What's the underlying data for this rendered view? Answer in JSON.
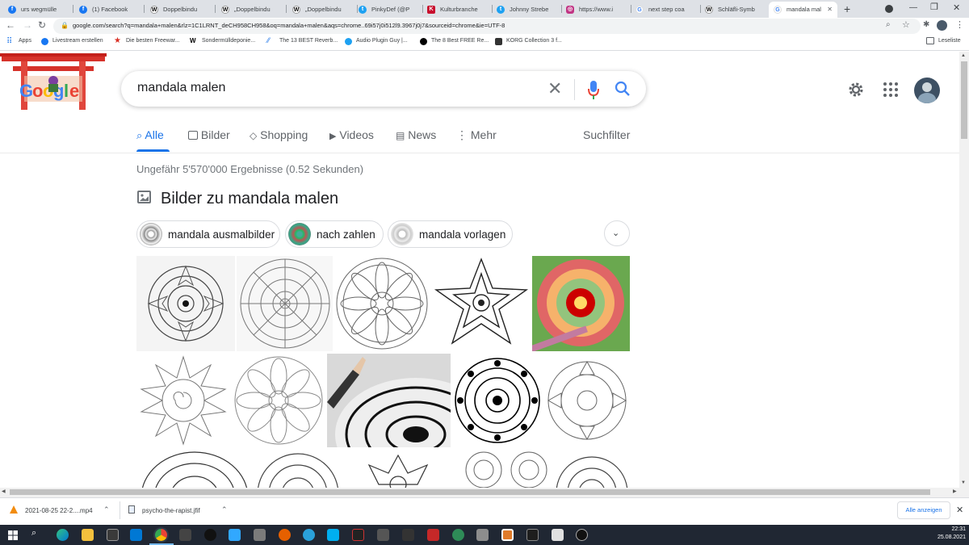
{
  "browser": {
    "tabs": [
      {
        "title": "urs wegmülle",
        "favicon": "facebook-icon",
        "color": "#1877f2"
      },
      {
        "title": "(1) Facebook",
        "favicon": "facebook-icon",
        "color": "#1877f2"
      },
      {
        "title": "Doppelbindu",
        "favicon": "wikipedia-icon",
        "color": "#000000"
      },
      {
        "title": "„Doppelbindu",
        "favicon": "wikipedia-icon",
        "color": "#000000"
      },
      {
        "title": "„Doppelbindu",
        "favicon": "wikipedia-icon",
        "color": "#000000"
      },
      {
        "title": "PinkyDef (@P",
        "favicon": "twitter-icon",
        "color": "#1da1f2"
      },
      {
        "title": "Kulturbranche",
        "favicon": "kultur-icon",
        "color": "#c8102e"
      },
      {
        "title": "Johnny Strebe",
        "favicon": "twitter-icon",
        "color": "#1da1f2"
      },
      {
        "title": "https://www.i",
        "favicon": "instagram-icon",
        "color": "#c13584"
      },
      {
        "title": "next step coa",
        "favicon": "google-icon",
        "color": "#4285f4"
      },
      {
        "title": "Schläfli-Symb",
        "favicon": "wikipedia-icon",
        "color": "#000000"
      },
      {
        "title": "mandala mal",
        "favicon": "google-icon",
        "color": "#4285f4"
      }
    ],
    "url": "google.com/search?q=mandala+malen&rlz=1C1LRNT_deCH958CH958&oq=mandala+malen&aqs=chrome..69i57j0i512l9.3967j0j7&sourceid=chrome&ie=UTF-8",
    "bookmarks": [
      {
        "label": "Apps",
        "icon": "apps-grid-icon"
      },
      {
        "label": "Livestream erstellen",
        "icon": "facebook-icon"
      },
      {
        "label": "Die besten Freewar...",
        "icon": "star-icon"
      },
      {
        "label": "Sondermülldeponie...",
        "icon": "wikipedia-icon"
      },
      {
        "label": "The 13 BEST Reverb...",
        "icon": "reverb-icon"
      },
      {
        "label": "Audio Plugin Guy |...",
        "icon": "twitter-icon"
      },
      {
        "label": "The 8 Best FREE Re...",
        "icon": "plugin-icon"
      },
      {
        "label": "KORG Collection 3 f...",
        "icon": "korg-icon"
      }
    ],
    "reading_list": "Leseliste"
  },
  "google": {
    "query": "mandala malen",
    "tabs": [
      {
        "label": "Alle",
        "icon": "search-icon"
      },
      {
        "label": "Bilder",
        "icon": "image-icon"
      },
      {
        "label": "Shopping",
        "icon": "tag-icon"
      },
      {
        "label": "Videos",
        "icon": "play-icon"
      },
      {
        "label": "News",
        "icon": "news-icon"
      },
      {
        "label": "Mehr",
        "icon": "more-vert-icon"
      }
    ],
    "search_tools": "Suchfilter",
    "result_stats": "Ungefähr 5'570'000 Ergebnisse (0.52 Sekunden)",
    "images_heading": "Bilder zu mandala malen",
    "chips": [
      {
        "label": "mandala ausmalbilder"
      },
      {
        "label": "nach zahlen"
      },
      {
        "label": "mandala vorlagen"
      }
    ]
  },
  "downloads": [
    {
      "name": "2021-08-25 22-2....mp4",
      "icon": "vlc-icon"
    },
    {
      "name": "psycho-the-rapist.jfif",
      "icon": "file-icon"
    }
  ],
  "downloads_show_all": "Alle anzeigen",
  "taskbar": {
    "time": "22:31",
    "date": "25.08.2021"
  },
  "colors": {
    "accent": "#1a73e8",
    "tabstrip": "#dee1e6",
    "taskbar": "#202733"
  }
}
